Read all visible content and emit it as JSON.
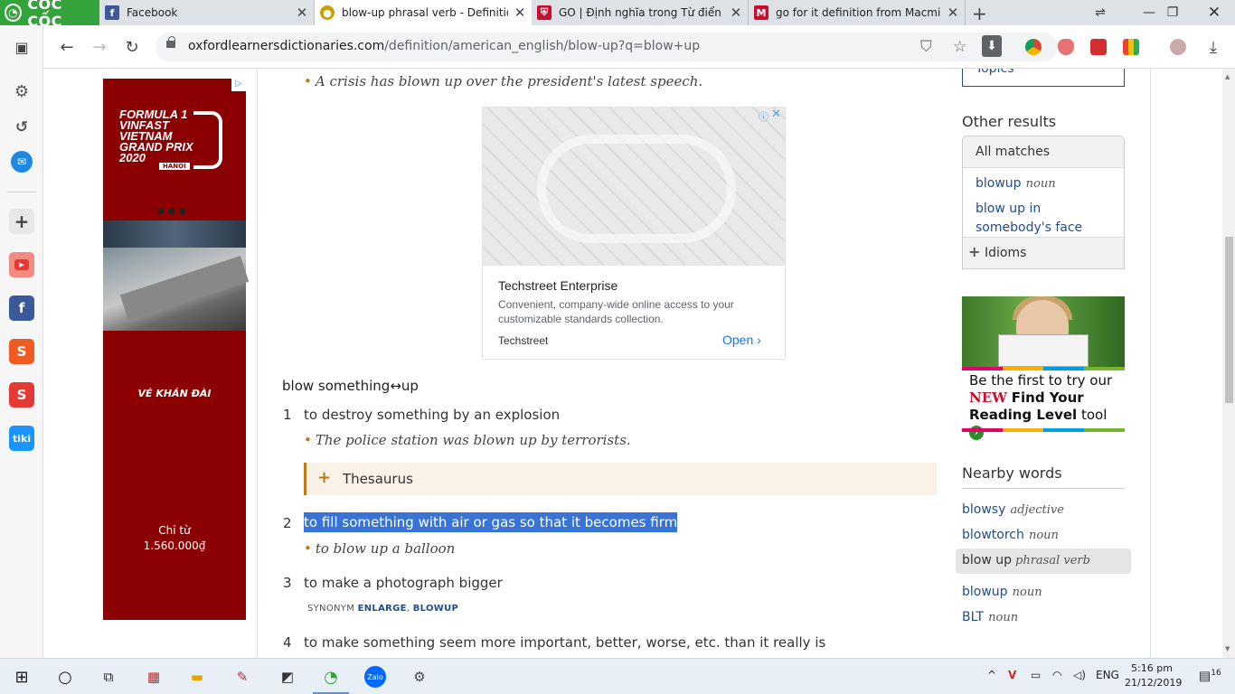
{
  "browser": {
    "brand": "CỐC CỐC",
    "tabs": [
      {
        "title": "Facebook",
        "icon": "facebook-icon",
        "color": "#3b5998"
      },
      {
        "title": "blow-up phrasal verb - Definition,",
        "icon": "oxford-icon",
        "color": "#c8a000"
      },
      {
        "title": "GO | Định nghĩa trong Từ điển tiến",
        "icon": "cambridge-icon",
        "color": "#c8102e"
      },
      {
        "title": "go for it definition from Macmillan",
        "icon": "macmillan-icon",
        "color": "#c8102e"
      }
    ],
    "url_host": "oxfordlearnersdictionaries.com",
    "url_path": "/definition/american_english/blow-up?q=blow+up"
  },
  "entry": {
    "top_example": "A crisis has blown up over the president's latest speech.",
    "heading": "blow something↔up",
    "senses": [
      {
        "num": "1",
        "def": "to destroy something by an explosion",
        "example": "The police station was blown up by terrorists."
      },
      {
        "num": "2",
        "def": "to fill something with air or gas so that it becomes firm",
        "example": "to blow up a balloon"
      },
      {
        "num": "3",
        "def": "to make a photograph bigger"
      },
      {
        "num": "4",
        "def": "to make something seem more important, better, worse, etc. than it really is"
      }
    ],
    "thesaurus": "Thesaurus",
    "synonym_label": "SYNONYM",
    "synonyms": [
      "ENLARGE",
      "BLOWUP"
    ]
  },
  "ad_center": {
    "title": "Techstreet Enterprise",
    "desc": "Convenient, company-wide online access to your customizable standards collection.",
    "source": "Techstreet",
    "cta": "Open"
  },
  "ad_left": {
    "line1": "FORMULA 1",
    "line2": "VINFAST",
    "line3": "VIETNAM",
    "line4": "GRAND PRIX",
    "line5": "2020",
    "hanoi": "HANOI",
    "brand_small": "VINFAST",
    "cta": "VÉ KHÁN ĐÀI",
    "price_label": "Chỉ từ",
    "price": "1.560.000₫"
  },
  "sidebar": {
    "topics": "Topics",
    "other_results": "Other results",
    "all_matches": "All matches",
    "matches": [
      {
        "word": "blowup",
        "pos": "noun"
      },
      {
        "word": "blow up in somebody's face",
        "pos": ""
      }
    ],
    "idioms": "Idioms",
    "promo_line1": "Be the first to try our",
    "promo_new": "NEW",
    "promo_line2": "Find Your",
    "promo_line3a": "Reading Level",
    "promo_line3b": "tool",
    "nearby_title": "Nearby words",
    "nearby": [
      {
        "word": "blowsy",
        "pos": "adjective"
      },
      {
        "word": "blowtorch",
        "pos": "noun"
      },
      {
        "word": "blow up",
        "pos": "phrasal verb"
      },
      {
        "word": "blowup",
        "pos": "noun"
      },
      {
        "word": "BLT",
        "pos": "noun"
      }
    ]
  },
  "taskbar": {
    "lang": "ENG",
    "time": "5:16 pm",
    "date": "21/12/2019",
    "notif": "16"
  }
}
